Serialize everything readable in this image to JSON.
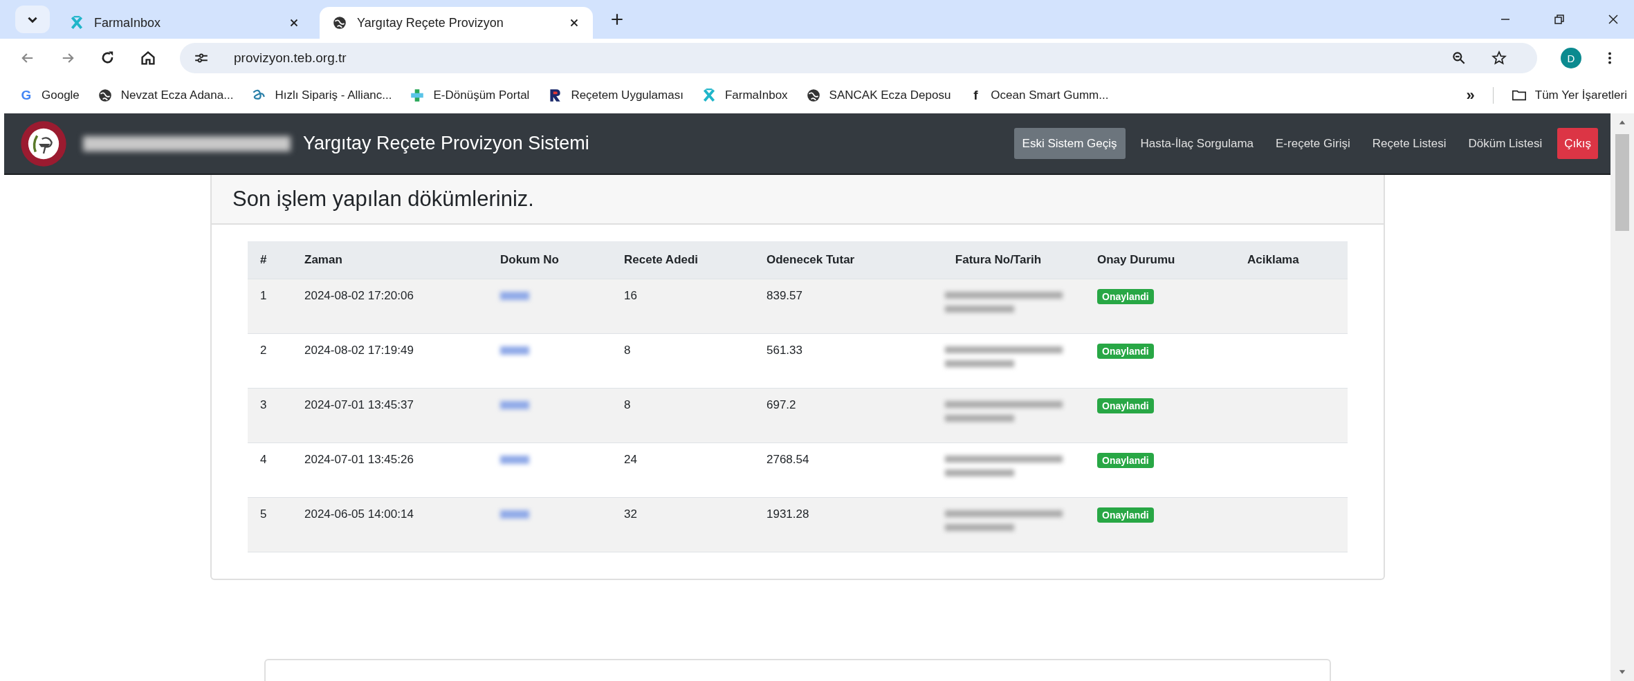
{
  "browser": {
    "tabs": [
      {
        "title": "FarmaInbox",
        "kind": "farma",
        "selected": false
      },
      {
        "title": "Yargıtay Reçete Provizyon",
        "kind": "globe",
        "selected": true
      }
    ],
    "address": "provizyon.teb.org.tr",
    "profile_initial": "D",
    "bookmarks": [
      {
        "label": "Google",
        "kind": "letter",
        "glyph": "G",
        "color": "#4285f4"
      },
      {
        "label": "Nevzat Ecza Adana...",
        "kind": "globe"
      },
      {
        "label": "Hızlı Sipariş - Allianc...",
        "kind": "knot"
      },
      {
        "label": "E-Dönüşüm Portal",
        "kind": "plus"
      },
      {
        "label": "Reçetem Uygulaması",
        "kind": "recetem"
      },
      {
        "label": "FarmaInbox",
        "kind": "farma"
      },
      {
        "label": "SANCAK Ecza Deposu",
        "kind": "globe"
      },
      {
        "label": "Ocean Smart Gumm...",
        "kind": "letter",
        "glyph": "f",
        "color": "#222222"
      }
    ],
    "bookmarks_overflow": "»",
    "all_bookmarks": "Tüm Yer İşaretleri"
  },
  "header": {
    "title": "Yargıtay Reçete Provizyon Sistemi",
    "nav": [
      {
        "label": "Eski Sistem Geçiş",
        "kind": "secondary"
      },
      {
        "label": "Hasta-İlaç Sorgulama",
        "kind": "link"
      },
      {
        "label": "E-reçete Girişi",
        "kind": "link"
      },
      {
        "label": "Reçete Listesi",
        "kind": "link"
      },
      {
        "label": "Döküm Listesi",
        "kind": "link"
      },
      {
        "label": "Çıkış",
        "kind": "danger"
      }
    ]
  },
  "card": {
    "title": "Son işlem yapılan dökümleriniz.",
    "columns": [
      "#",
      "Zaman",
      "Dokum No",
      "Recete Adedi",
      "Odenecek Tutar",
      "Fatura No/Tarih",
      "Onay Durumu",
      "Aciklama"
    ],
    "rows": [
      {
        "index": "1",
        "time": "2024-08-02 17:20:06",
        "count": "16",
        "amount": "839.57",
        "status": "Onaylandi"
      },
      {
        "index": "2",
        "time": "2024-08-02 17:19:49",
        "count": "8",
        "amount": "561.33",
        "status": "Onaylandi"
      },
      {
        "index": "3",
        "time": "2024-07-01 13:45:37",
        "count": "8",
        "amount": "697.2",
        "status": "Onaylandi"
      },
      {
        "index": "4",
        "time": "2024-07-01 13:45:26",
        "count": "24",
        "amount": "2768.54",
        "status": "Onaylandi"
      },
      {
        "index": "5",
        "time": "2024-06-05 14:00:14",
        "count": "32",
        "amount": "1931.28",
        "status": "Onaylandi"
      }
    ]
  }
}
